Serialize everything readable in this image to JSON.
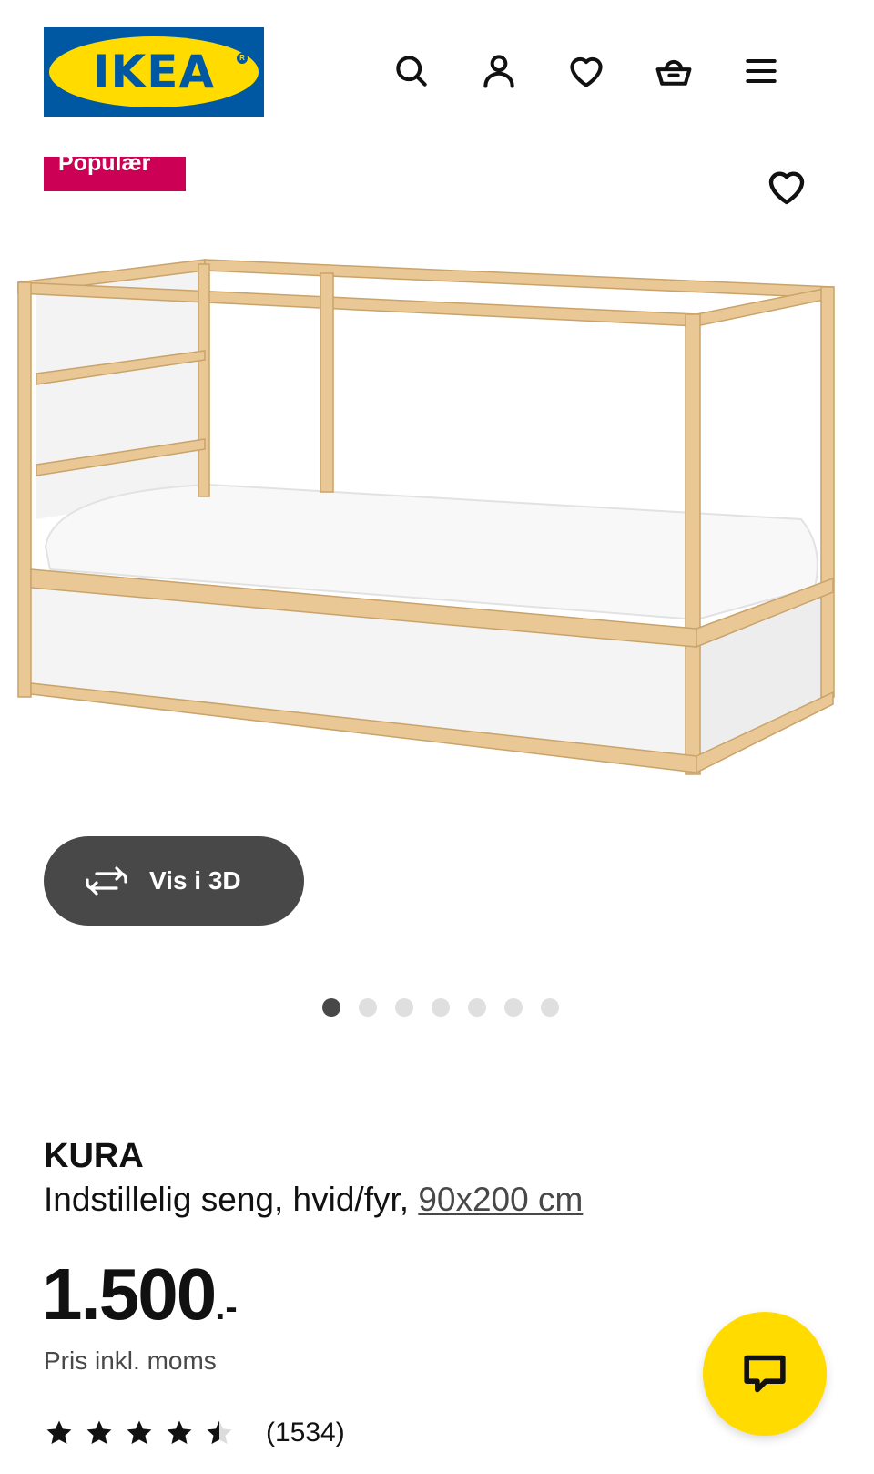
{
  "header": {
    "logo_text": "IKEA",
    "logo_colors": {
      "blue": "#0058a3",
      "yellow": "#ffdb00"
    },
    "icons": [
      "search-icon",
      "user-icon",
      "heart-icon",
      "basket-icon",
      "menu-icon"
    ]
  },
  "badge": {
    "label": "Populær",
    "color": "#cc0055"
  },
  "gallery": {
    "view3d_label": "Vis i 3D",
    "dots_total": 7,
    "dots_active_index": 0
  },
  "product": {
    "name": "KURA",
    "description": "Indstillelig seng, hvid/fyr,",
    "size_link": "90x200 cm",
    "price": "1.500",
    "price_suffix": ".-",
    "price_note": "Pris inkl. moms",
    "rating": {
      "stars": 4.5,
      "max": 5,
      "count": "(1534)"
    }
  },
  "chat": {
    "icon": "chat-icon",
    "color": "#ffdb00"
  }
}
